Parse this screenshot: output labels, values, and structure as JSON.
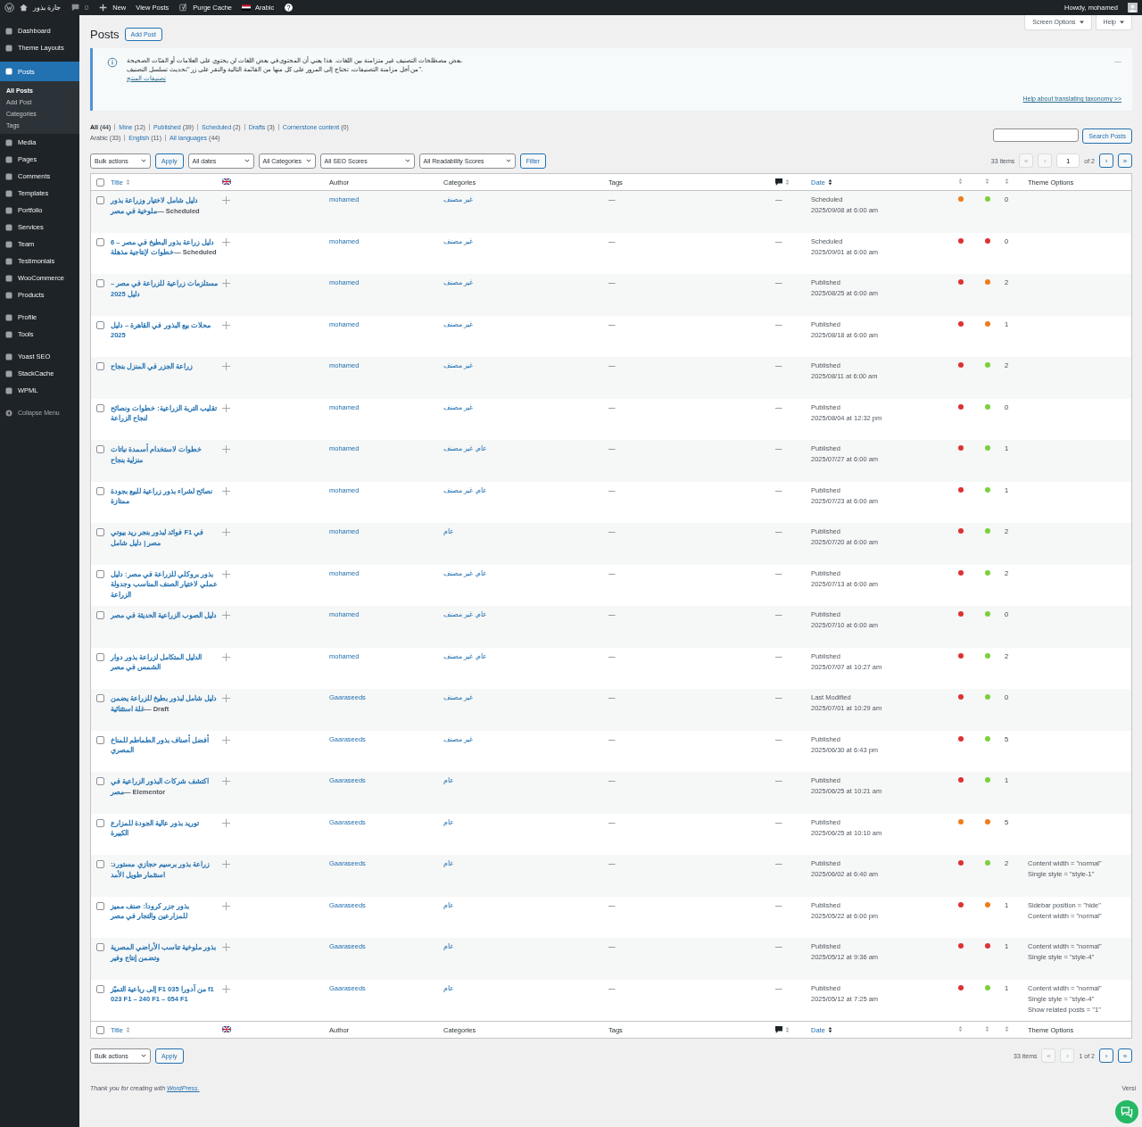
{
  "admin_bar": {
    "site_name": "جارة بذور",
    "comments_count": "0",
    "new_label": "New",
    "view_posts": "View Posts",
    "purge_cache": "Purge Cache",
    "language": "Arabic",
    "howdy": "Howdy, mohamed"
  },
  "sidebar": {
    "groups": [
      [
        {
          "label": "Dashboard",
          "selected": false
        },
        {
          "label": "Theme Layouts",
          "selected": false
        }
      ],
      [
        {
          "label": "Posts",
          "selected": true,
          "children": [
            {
              "label": "All Posts",
              "selected": true
            },
            {
              "label": "Add Post",
              "selected": false
            },
            {
              "label": "Categories",
              "selected": false
            },
            {
              "label": "Tags",
              "selected": false
            }
          ]
        },
        {
          "label": "Media",
          "selected": false
        },
        {
          "label": "Pages",
          "selected": false
        },
        {
          "label": "Comments",
          "selected": false
        },
        {
          "label": "Templates",
          "selected": false
        },
        {
          "label": "Portfolio",
          "selected": false
        },
        {
          "label": "Services",
          "selected": false
        },
        {
          "label": "Team",
          "selected": false
        },
        {
          "label": "Testimonials",
          "selected": false
        },
        {
          "label": "WooCommerce",
          "selected": false
        },
        {
          "label": "Products",
          "selected": false
        }
      ],
      [
        {
          "label": "Profile",
          "selected": false
        },
        {
          "label": "Tools",
          "selected": false
        }
      ],
      [
        {
          "label": "Yoast SEO",
          "selected": false
        },
        {
          "label": "StackCache",
          "selected": false
        },
        {
          "label": "WPML",
          "selected": false
        }
      ]
    ],
    "collapse": "Collapse Menu"
  },
  "header": {
    "title": "Posts",
    "add_button": "Add Post",
    "screen_options": "Screen Options",
    "help": "Help"
  },
  "notice": {
    "lines": [
      "بعض مصطلحات التصنيف غير متزامنة بين اللغات. هذا يعني أن المحتوى في بعض اللغات لن يحتوي على العلامات أو الفئات الصحيحة.",
      "من أجل مزامنة التصنيفات، تحتاج إلى المرور على كل منها من القائمة التالية والنقر على زر \"تحديث تسلسل التصنيف\"."
    ],
    "link": "تصنيفات المنتج",
    "help_link": "Help about translating taxonomy >>",
    "dismiss": "—"
  },
  "status_links": [
    {
      "label": "All",
      "count": "(44)",
      "selected": true
    },
    {
      "label": "Mine",
      "count": "(12)",
      "selected": false
    },
    {
      "label": "Published",
      "count": "(39)",
      "selected": false
    },
    {
      "label": "Scheduled",
      "count": "(2)",
      "selected": false
    },
    {
      "label": "Drafts",
      "count": "(3)",
      "selected": false
    },
    {
      "label": "Cornerstone content",
      "count": "(0)",
      "selected": false
    }
  ],
  "language_links": [
    {
      "label": "Arabic",
      "count": "(33)",
      "selected": true
    },
    {
      "label": "English",
      "count": "(11)",
      "selected": false
    },
    {
      "label": "All languages",
      "count": "(44)",
      "selected": false
    }
  ],
  "search": {
    "button": "Search Posts"
  },
  "filters": {
    "bulk": "Bulk actions",
    "apply": "Apply",
    "selects": [
      "All dates",
      "All Categories",
      "All SEO Scores",
      "All Readability Scores"
    ],
    "filter": "Filter"
  },
  "pagination": {
    "items": "33 items",
    "first": "«",
    "prev": "‹",
    "page": "1",
    "of": "of 2",
    "next": "›",
    "last": "»"
  },
  "columns": {
    "checked": false,
    "title": "Title",
    "author": "Author",
    "categories": "Categories",
    "tags": "Tags",
    "date": "Date",
    "theme": "Theme Options"
  },
  "rows": [
    {
      "checked": false,
      "title": "دليل شامل لاختيار وزراعة بذور ملوخية في مصر",
      "state": "— Scheduled",
      "author": "mohamed",
      "categories": "غير مصنف",
      "tags": "—",
      "comments": "—",
      "status": "Scheduled",
      "date": "2025/09/08 at 6:00 am",
      "seo": {
        "color": "#ee7c1b"
      },
      "readability": {
        "color": "#7ad03a"
      },
      "links": "0",
      "theme_options": []
    },
    {
      "checked": false,
      "title": "دليل زراعة بذور البطيخ في مصر – 6 خطوات لإنتاجية مذهلة",
      "state": "— Scheduled",
      "author": "mohamed",
      "categories": "غير مصنف",
      "tags": "—",
      "comments": "—",
      "status": "Scheduled",
      "date": "2025/09/01 at 6:00 am",
      "seo": {
        "color": "#dc3232"
      },
      "readability": {
        "color": "#dc3232"
      },
      "links": "0",
      "theme_options": []
    },
    {
      "checked": false,
      "title": "مستلزمات زراعية للزراعة في مصر – دليل 2025",
      "state": "",
      "author": "mohamed",
      "categories": "غير مصنف",
      "tags": "—",
      "comments": "—",
      "status": "Published",
      "date": "2025/08/25 at 6:00 am",
      "seo": {
        "color": "#dc3232"
      },
      "readability": {
        "color": "#ee7c1b"
      },
      "links": "2",
      "theme_options": []
    },
    {
      "checked": false,
      "title": "محلات بيع البذور في القاهرة – دليل 2025",
      "state": "",
      "author": "mohamed",
      "categories": "غير مصنف",
      "tags": "—",
      "comments": "—",
      "status": "Published",
      "date": "2025/08/18 at 6:00 am",
      "seo": {
        "color": "#dc3232"
      },
      "readability": {
        "color": "#ee7c1b"
      },
      "links": "1",
      "theme_options": []
    },
    {
      "checked": false,
      "title": "زراعة الجزر في المنزل بنجاح",
      "state": "",
      "author": "mohamed",
      "categories": "غير مصنف",
      "tags": "—",
      "comments": "—",
      "status": "Published",
      "date": "2025/08/11 at 6:00 am",
      "seo": {
        "color": "#dc3232"
      },
      "readability": {
        "color": "#7ad03a"
      },
      "links": "2",
      "theme_options": []
    },
    {
      "checked": false,
      "title": "تقليب التربة الزراعية: خطوات ونصائح لنجاح الزراعة",
      "state": "",
      "author": "mohamed",
      "categories": "غير مصنف",
      "tags": "—",
      "comments": "—",
      "status": "Published",
      "date": "2025/08/04 at 12:32 pm",
      "seo": {
        "color": "#dc3232"
      },
      "readability": {
        "color": "#7ad03a"
      },
      "links": "0",
      "theme_options": []
    },
    {
      "checked": false,
      "title": "خطوات لاستخدام أسمدة نباتات منزلية بنجاح",
      "state": "",
      "author": "mohamed",
      "categories": "عام, غير مصنف",
      "tags": "—",
      "comments": "—",
      "status": "Published",
      "date": "2025/07/27 at 6:00 am",
      "seo": {
        "color": "#dc3232"
      },
      "readability": {
        "color": "#7ad03a"
      },
      "links": "1",
      "theme_options": []
    },
    {
      "checked": false,
      "title": "نصائح لشراء بذور زراعية للبيع بجودة ممتازة",
      "state": "",
      "author": "mohamed",
      "categories": "عام, غير مصنف",
      "tags": "—",
      "comments": "—",
      "status": "Published",
      "date": "2025/07/23 at 6:00 am",
      "seo": {
        "color": "#dc3232"
      },
      "readability": {
        "color": "#7ad03a"
      },
      "links": "1",
      "theme_options": []
    },
    {
      "checked": false,
      "title": "فوائد لبذور بنجر ريد بيوتي F1 في مصر | دليل شامل",
      "state": "",
      "author": "mohamed",
      "categories": "عام",
      "tags": "—",
      "comments": "—",
      "status": "Published",
      "date": "2025/07/20 at 6:00 am",
      "seo": {
        "color": "#dc3232"
      },
      "readability": {
        "color": "#7ad03a"
      },
      "links": "2",
      "theme_options": []
    },
    {
      "checked": false,
      "title": "بذور بروكلي للزراعة في مصر: دليل عملي لاختيار الصنف المناسب وجدولة الزراعة",
      "state": "",
      "author": "mohamed",
      "categories": "عام, غير مصنف",
      "tags": "—",
      "comments": "—",
      "status": "Published",
      "date": "2025/07/13 at 6:00 am",
      "seo": {
        "color": "#dc3232"
      },
      "readability": {
        "color": "#7ad03a"
      },
      "links": "2",
      "theme_options": []
    },
    {
      "checked": false,
      "title": "دليل الصوب الزراعية الحديثة في مصر",
      "state": "",
      "author": "mohamed",
      "categories": "عام, غير مصنف",
      "tags": "—",
      "comments": "—",
      "status": "Published",
      "date": "2025/07/10 at 6:00 am",
      "seo": {
        "color": "#dc3232"
      },
      "readability": {
        "color": "#7ad03a"
      },
      "links": "0",
      "theme_options": []
    },
    {
      "checked": false,
      "title": "الدليل المتكامل لزراعة بذور دوار الشمس في مصر",
      "state": "",
      "author": "mohamed",
      "categories": "عام, غير مصنف",
      "tags": "—",
      "comments": "—",
      "status": "Published",
      "date": "2025/07/07 at 10:27 am",
      "seo": {
        "color": "#dc3232"
      },
      "readability": {
        "color": "#7ad03a"
      },
      "links": "2",
      "theme_options": []
    },
    {
      "checked": false,
      "title": "دليل شامل لبذور بطيخ للزراعة يضمن غلة استثنائية",
      "state": "— Draft",
      "author": "Gaaraseeds",
      "categories": "غير مصنف",
      "tags": "—",
      "comments": "—",
      "status": "Last Modified",
      "date": "2025/07/01 at 10:29 am",
      "seo": {
        "color": "#dc3232"
      },
      "readability": {
        "color": "#7ad03a"
      },
      "links": "0",
      "theme_options": []
    },
    {
      "checked": false,
      "title": "أفضل أصناف بذور الطماطم للمناخ المصري",
      "state": "",
      "author": "Gaaraseeds",
      "categories": "غير مصنف",
      "tags": "—",
      "comments": "—",
      "status": "Published",
      "date": "2025/06/30 at 6:43 pm",
      "seo": {
        "color": "#dc3232"
      },
      "readability": {
        "color": "#7ad03a"
      },
      "links": "5",
      "theme_options": []
    },
    {
      "checked": false,
      "title": "اكتشف شركات البذور الزراعية في مصر",
      "state": "— Elementor",
      "author": "Gaaraseeds",
      "categories": "عام",
      "tags": "—",
      "comments": "—",
      "status": "Published",
      "date": "2025/06/25 at 10:21 am",
      "seo": {
        "color": "#dc3232"
      },
      "readability": {
        "color": "#7ad03a"
      },
      "links": "1",
      "theme_options": []
    },
    {
      "checked": false,
      "title": "توريد بذور عالية الجودة للمزارع الكبيرة",
      "state": "",
      "author": "Gaaraseeds",
      "categories": "عام",
      "tags": "—",
      "comments": "—",
      "status": "Published",
      "date": "2025/06/25 at 10:10 am",
      "seo": {
        "color": "#ee7c1b"
      },
      "readability": {
        "color": "#ee7c1b"
      },
      "links": "5",
      "theme_options": []
    },
    {
      "checked": false,
      "title": "زراعة بذور برسيم حجازي مستورد: استثمار طويل الأمد",
      "state": "",
      "author": "Gaaraseeds",
      "categories": "عام",
      "tags": "—",
      "comments": "—",
      "status": "Published",
      "date": "2025/06/02 at 6:40 am",
      "seo": {
        "color": "#dc3232"
      },
      "readability": {
        "color": "#7ad03a"
      },
      "links": "2",
      "theme_options": [
        "Content width = \"normal\"",
        "Single style = \"style-1\""
      ]
    },
    {
      "checked": false,
      "title": "بذور جزر كرودا: صنف مميز للمزارعين والتجار في مصر",
      "state": "",
      "author": "Gaaraseeds",
      "categories": "عام",
      "tags": "—",
      "comments": "—",
      "status": "Published",
      "date": "2025/05/22 at 6:00 pm",
      "seo": {
        "color": "#dc3232"
      },
      "readability": {
        "color": "#ee7c1b"
      },
      "links": "1",
      "theme_options": [
        "Sidebar position = \"hide\"",
        "Content width = \"normal\""
      ]
    },
    {
      "checked": false,
      "title": "بذور ملوخية تناسب الأراضي المصرية وتضمن إنتاج وفير",
      "state": "",
      "author": "Gaaraseeds",
      "categories": "عام",
      "tags": "—",
      "comments": "—",
      "status": "Published",
      "date": "2025/05/12 at 9:36 am",
      "seo": {
        "color": "#dc3232"
      },
      "readability": {
        "color": "#dc3232"
      },
      "links": "1",
      "theme_options": [
        "Content width = \"normal\"",
        "Single style = \"style-4\""
      ]
    },
    {
      "checked": false,
      "title": "إلى رباعية التميّز F1 035 من آدورا f1 023 F1 – 240 F1 – 054 F1",
      "state": "",
      "author": "Gaaraseeds",
      "categories": "عام",
      "tags": "—",
      "comments": "—",
      "status": "Published",
      "date": "2025/05/12 at 7:25 am",
      "seo": {
        "color": "#dc3232"
      },
      "readability": {
        "color": "#7ad03a"
      },
      "links": "1",
      "theme_options": [
        "Content width = \"normal\"",
        "Single style = \"style-4\"",
        "Show related posts = \"1\""
      ]
    }
  ],
  "footer_columns": {
    "checked": false,
    "title": "Title",
    "author": "Author",
    "categories": "Categories",
    "tags": "Tags",
    "date": "Date",
    "theme": "Theme Options"
  },
  "bottom_nav": {
    "bulk": "Bulk actions",
    "apply": "Apply",
    "items": "33 items",
    "first": "«",
    "prev": "‹",
    "page": "1 of 2",
    "next": "›",
    "last": "»"
  },
  "footer": {
    "thanks": "Thank you for creating with",
    "link": "WordPress.",
    "version": "Versi"
  }
}
